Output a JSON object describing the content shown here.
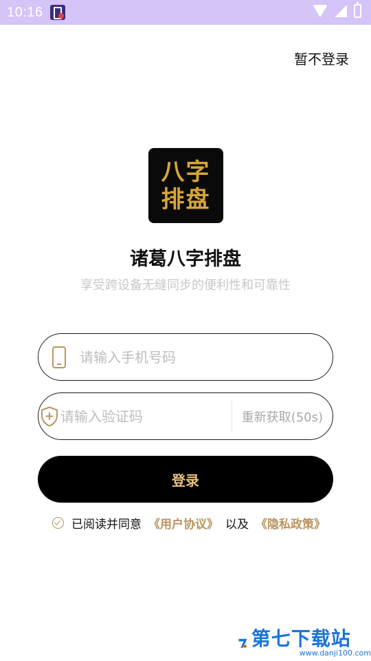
{
  "status_bar": {
    "time": "10:16",
    "icons": [
      "app-notification-icon",
      "wifi-icon",
      "signal-icon",
      "battery-icon"
    ]
  },
  "header": {
    "skip_label": "暂不登录"
  },
  "app": {
    "logo_line1": "八字",
    "logo_line2": "排盘",
    "title": "诸葛八字排盘",
    "subtitle": "享受跨设备无缝同步的便利性和可靠性"
  },
  "form": {
    "phone": {
      "value": "",
      "placeholder": "请输入手机号码",
      "icon": "phone-icon"
    },
    "code": {
      "value": "",
      "placeholder": "请输入验证码",
      "icon": "shield-plus-icon",
      "resend_label": "重新获取(50s)"
    },
    "login_label": "登录"
  },
  "agreement": {
    "checked": true,
    "prefix": "已阅读并同意",
    "user_agreement": "《用户协议》",
    "connector": "以及",
    "privacy_policy": "《隐私政策》"
  },
  "watermark": {
    "text": "第七下载站",
    "url": "www.danji100.com"
  },
  "colors": {
    "status_bar": "#d4c4f7",
    "accent_gold": "#b89560",
    "button_bg": "#000000",
    "button_text": "#e7c07f",
    "logo_gold": "#d8a53a",
    "watermark_blue": "#1a73d9"
  }
}
